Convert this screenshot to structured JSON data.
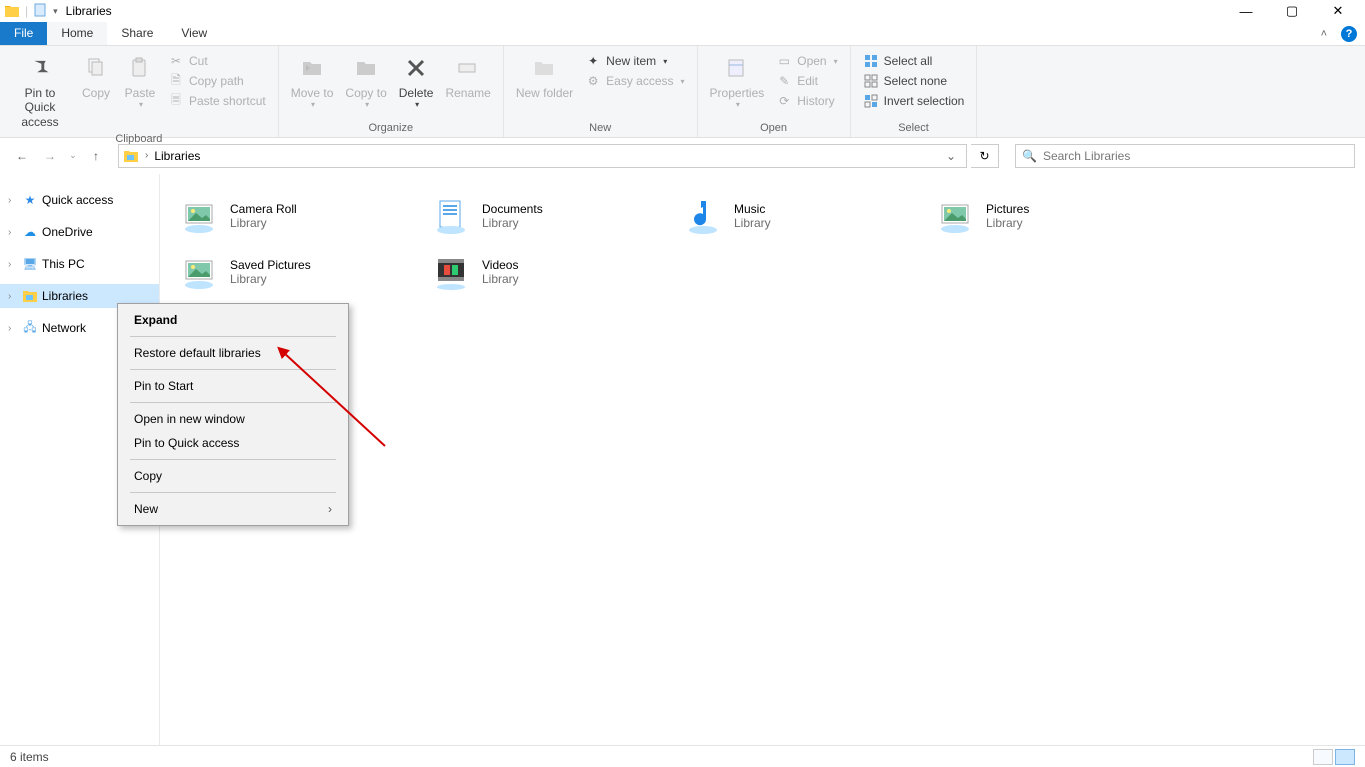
{
  "window": {
    "title": "Libraries"
  },
  "tabs": {
    "file": "File",
    "home": "Home",
    "share": "Share",
    "view": "View"
  },
  "ribbon": {
    "clipboard": {
      "label": "Clipboard",
      "pin": "Pin to Quick access",
      "copy": "Copy",
      "paste": "Paste",
      "cut": "Cut",
      "copy_path": "Copy path",
      "paste_shortcut": "Paste shortcut"
    },
    "organize": {
      "label": "Organize",
      "move_to": "Move to",
      "copy_to": "Copy to",
      "delete": "Delete",
      "rename": "Rename"
    },
    "new": {
      "label": "New",
      "new_folder": "New folder",
      "new_item": "New item",
      "easy_access": "Easy access"
    },
    "open": {
      "label": "Open",
      "properties": "Properties",
      "open": "Open",
      "edit": "Edit",
      "history": "History"
    },
    "select": {
      "label": "Select",
      "select_all": "Select all",
      "select_none": "Select none",
      "invert": "Invert selection"
    }
  },
  "address": {
    "crumb": "Libraries"
  },
  "search": {
    "placeholder": "Search Libraries"
  },
  "tree": {
    "quick_access": "Quick access",
    "onedrive": "OneDrive",
    "this_pc": "This PC",
    "libraries": "Libraries",
    "network": "Network"
  },
  "libs": [
    {
      "name": "Camera Roll",
      "type": "Library",
      "icon": "image"
    },
    {
      "name": "Documents",
      "type": "Library",
      "icon": "doc"
    },
    {
      "name": "Music",
      "type": "Library",
      "icon": "music"
    },
    {
      "name": "Pictures",
      "type": "Library",
      "icon": "image"
    },
    {
      "name": "Saved Pictures",
      "type": "Library",
      "icon": "image"
    },
    {
      "name": "Videos",
      "type": "Library",
      "icon": "video"
    }
  ],
  "context_menu": {
    "expand": "Expand",
    "restore": "Restore default libraries",
    "pin_start": "Pin to Start",
    "open_new": "Open in new window",
    "pin_quick": "Pin to Quick access",
    "copy": "Copy",
    "new": "New"
  },
  "status": {
    "text": "6 items"
  }
}
